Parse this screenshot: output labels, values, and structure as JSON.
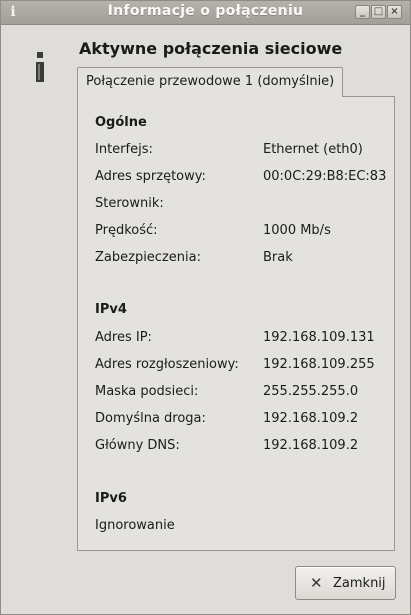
{
  "window": {
    "title": "Informacje o połączeniu",
    "title_icon": "info-icon",
    "buttons": [
      "minimize-icon",
      "maximize-icon",
      "close-icon"
    ]
  },
  "heading": "Aktywne połączenia sieciowe",
  "tab": {
    "label": "Połączenie przewodowe 1 (domyślnie)"
  },
  "general": {
    "title": "Ogólne",
    "rows": [
      {
        "label": "Interfejs:",
        "value": "Ethernet (eth0)"
      },
      {
        "label": "Adres sprzętowy:",
        "value": "00:0C:29:B8:EC:83"
      },
      {
        "label": "Sterownik:",
        "value": ""
      },
      {
        "label": "Prędkość:",
        "value": "1000 Mb/s"
      },
      {
        "label": "Zabezpieczenia:",
        "value": "Brak"
      }
    ]
  },
  "ipv4": {
    "title": "IPv4",
    "rows": [
      {
        "label": "Adres IP:",
        "value": "192.168.109.131"
      },
      {
        "label": "Adres rozgłoszeniowy:",
        "value": "192.168.109.255"
      },
      {
        "label": "Maska podsieci:",
        "value": "255.255.255.0"
      },
      {
        "label": "Domyślna droga:",
        "value": "192.168.109.2"
      },
      {
        "label": "Główny DNS:",
        "value": "192.168.109.2"
      }
    ]
  },
  "ipv6": {
    "title": "IPv6",
    "status": "Ignorowanie"
  },
  "footer": {
    "close_label": "Zamknij",
    "close_icon": "x-icon"
  },
  "colors": {
    "titlebar": "#a9a59f",
    "window_bg": "#dfddd9",
    "panel_bg": "#e4e2de"
  }
}
